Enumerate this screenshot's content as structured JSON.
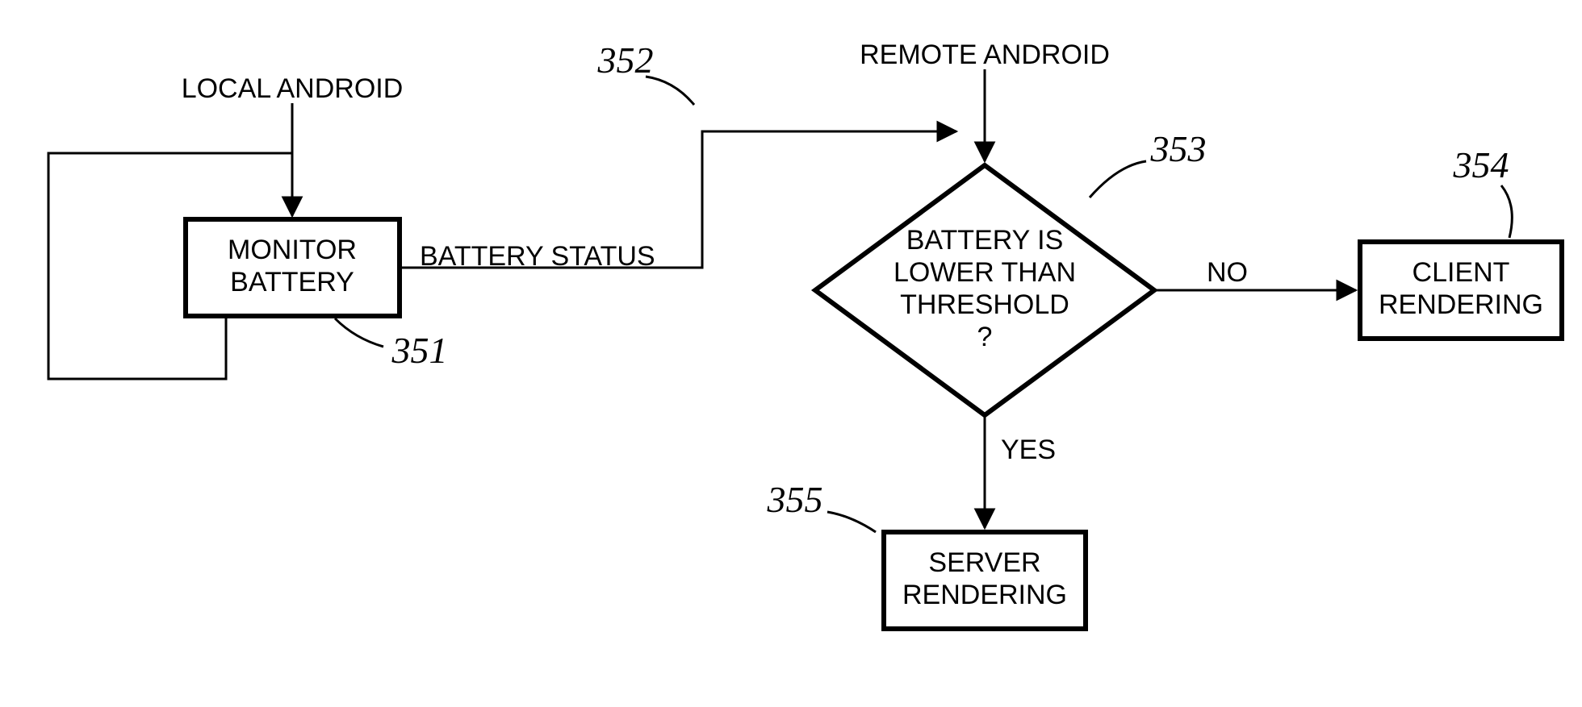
{
  "labels": {
    "local_android": "LOCAL ANDROID",
    "remote_android": "REMOTE ANDROID",
    "battery_status": "BATTERY STATUS",
    "no": "NO",
    "yes": "YES"
  },
  "nodes": {
    "monitor_battery": {
      "l1": "MONITOR",
      "l2": "BATTERY"
    },
    "decision": {
      "l1": "BATTERY IS",
      "l2": "LOWER THAN",
      "l3": "THRESHOLD",
      "l4": "?"
    },
    "client_rendering": {
      "l1": "CLIENT",
      "l2": "RENDERING"
    },
    "server_rendering": {
      "l1": "SERVER",
      "l2": "RENDERING"
    }
  },
  "refs": {
    "r351": "351",
    "r352": "352",
    "r353": "353",
    "r354": "354",
    "r355": "355"
  }
}
